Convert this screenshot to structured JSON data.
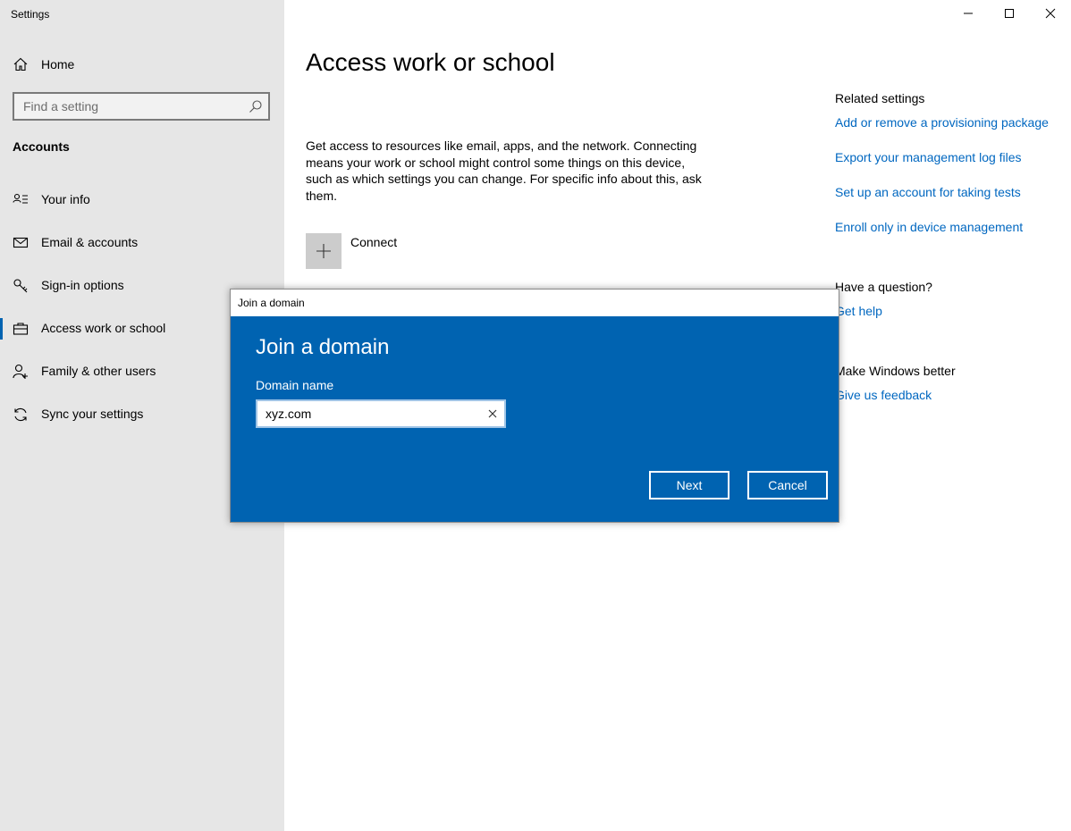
{
  "app": {
    "title": "Settings"
  },
  "nav": {
    "home_label": "Home",
    "search_placeholder": "Find a setting",
    "section_title": "Accounts",
    "items": [
      {
        "label": "Your info",
        "icon": "person-card-icon"
      },
      {
        "label": "Email & accounts",
        "icon": "mail-icon"
      },
      {
        "label": "Sign-in options",
        "icon": "key-icon"
      },
      {
        "label": "Access work or school",
        "icon": "briefcase-icon",
        "active": true
      },
      {
        "label": "Family & other users",
        "icon": "add-person-icon"
      },
      {
        "label": "Sync your settings",
        "icon": "sync-icon"
      }
    ]
  },
  "main": {
    "title": "Access work or school",
    "description": "Get access to resources like email, apps, and the network. Connecting means your work or school might control some things on this device, such as which settings you can change. For specific info about this, ask them.",
    "connect_label": "Connect"
  },
  "rail": {
    "related_header": "Related settings",
    "related_links": [
      "Add or remove a provisioning package",
      "Export your management log files",
      "Set up an account for taking tests",
      "Enroll only in device management"
    ],
    "question_header": "Have a question?",
    "help_link": "Get help",
    "better_header": "Make Windows better",
    "feedback_link": "Give us feedback"
  },
  "dialog": {
    "window_title": "Join a domain",
    "heading": "Join a domain",
    "field_label": "Domain name",
    "field_value": "xyz.com",
    "next_label": "Next",
    "cancel_label": "Cancel"
  },
  "colors": {
    "accent": "#0063b1",
    "link": "#0067c0",
    "nav_bg": "#e6e6e6"
  }
}
